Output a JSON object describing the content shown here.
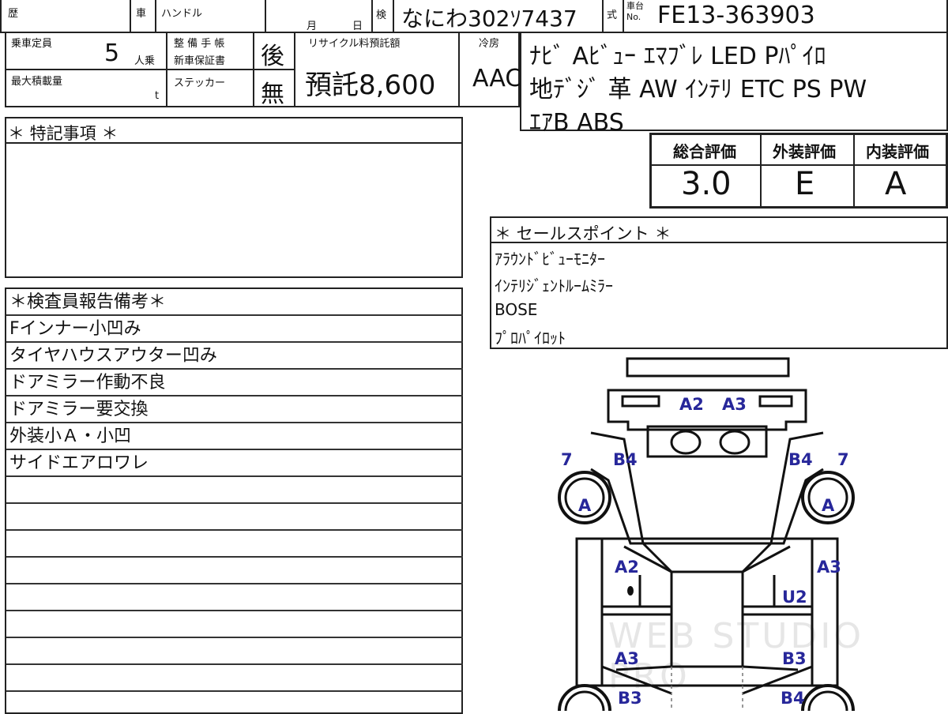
{
  "header": {
    "history_label": "歴",
    "car_label": "車",
    "handle_label": "ハンドル",
    "month_label": "月",
    "day_label": "日",
    "inspection_label": "検",
    "inspection_value": "なにわ302ｿ7437",
    "type_label": "式",
    "chassis_label_top": "車台",
    "chassis_label_bottom": "No.",
    "chassis_value": "FE13-363903"
  },
  "specs": {
    "capacity_label": "乗車定員",
    "capacity_value": "5",
    "capacity_unit": "人乗",
    "max_load_label": "最大積載量",
    "max_load_unit": "t",
    "maintenance_label_1": "整 備 手 帳",
    "maintenance_label_2": "新車保証書",
    "maintenance_value": "後",
    "sticker_label": "ステッカー",
    "sticker_value": "無",
    "recycle_label": "リサイクル料預託額",
    "recycle_value": "預託8,600",
    "ac_label": "冷房",
    "ac_value": "AAC"
  },
  "equipment": {
    "line1": "ﾅﾋﾞ Aﾋﾞｭｰ ｴﾏﾌﾞﾚ LED Pﾊﾟｲﾛ",
    "line2": "地ﾃﾞｼﾞ 革 AW ｲﾝﾃﾘ ETC PS PW",
    "line3": "ｴｱB ABS"
  },
  "ratings": {
    "overall_label": "総合評価",
    "overall_value": "3.0",
    "exterior_label": "外装評価",
    "exterior_value": "E",
    "interior_label": "内装評価",
    "interior_value": "A"
  },
  "special_notes": {
    "title": "＊ 特記事項 ＊"
  },
  "inspector_notes": {
    "title": "＊検査員報告備考＊",
    "lines": [
      "Fインナー小凹み",
      "タイヤハウスアウター凹み",
      "ドアミラー作動不良",
      "ドアミラー要交換",
      "外装小Ａ・小凹",
      "サイドエアロワレ"
    ]
  },
  "sales_points": {
    "title": "＊ セールスポイント ＊",
    "items": [
      "ｱﾗｳﾝﾄﾞﾋﾞｭｰﾓﾆﾀｰ",
      "ｲﾝﾃﾘｼﾞｪﾝﾄﾙｰﾑﾐﾗｰ",
      "BOSE",
      "ﾌﾟﾛﾊﾟｲﾛｯﾄ"
    ]
  },
  "damage_labels": {
    "front_a2": "A2",
    "front_a3": "A3",
    "left_7": "7",
    "left_b4": "B4",
    "right_b4": "B4",
    "right_7": "7",
    "left_wheel": "A",
    "right_wheel": "A",
    "left_door_front": "A2",
    "right_side_front": "A3",
    "right_door_front": "U2",
    "left_door_rear": "A3",
    "right_door_rear": "B3",
    "left_rear": "B3",
    "right_rear": "B4"
  },
  "watermark": "WEB STUDIO PRO"
}
